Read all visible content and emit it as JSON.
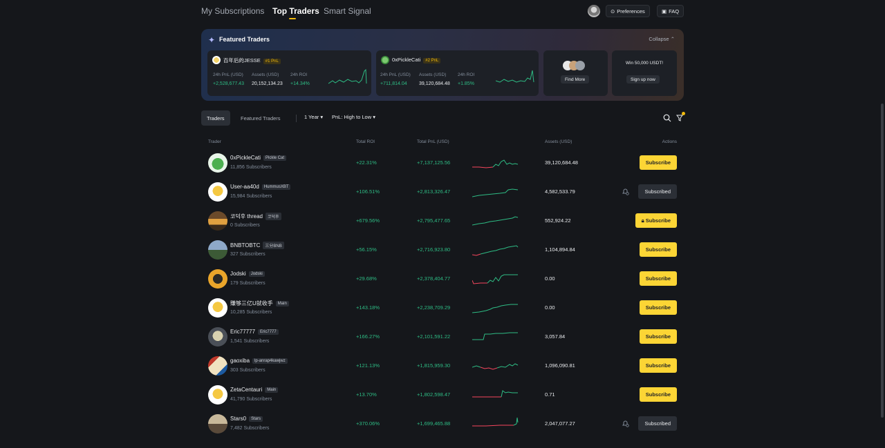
{
  "nav": {
    "tabs": [
      "My Subscriptions",
      "Top Traders",
      "Smart Signal"
    ],
    "preferences_label": "Preferences",
    "faq_label": "FAQ"
  },
  "featured": {
    "title": "Featured Traders",
    "collapse_label": "Collapse",
    "cards": [
      {
        "name": "百年后的JESSE",
        "rank": "#1 PnL",
        "pnl_label": "24h PnL (USD)",
        "pnl": "+2,528,677.43",
        "assets_label": "Assets (USD)",
        "assets": "20,152,134.23",
        "roi_label": "24h ROI",
        "roi": "+14.34%"
      },
      {
        "name": "0xPickleCati",
        "rank": "#2 PnL",
        "pnl_label": "24h PnL (USD)",
        "pnl": "+711,814.04",
        "assets_label": "Assets (USD)",
        "assets": "39,120,684.48",
        "roi_label": "24h ROI",
        "roi": "+1.85%"
      }
    ],
    "find_more_label": "Find More",
    "promo_text": "Win 50,000 USDT!",
    "signup_label": "Sign up now"
  },
  "filters": {
    "tabs": [
      "Traders",
      "Featured Traders"
    ],
    "period": "1 Year",
    "sort": "PnL: High to Low"
  },
  "table": {
    "headers": {
      "trader": "Trader",
      "roi": "Total ROI",
      "pnl": "Total PnL (USD)",
      "assets": "Assets (USD)",
      "actions": "Actions"
    },
    "rows": [
      {
        "name": "0xPickleCati",
        "tag": "Pickle Cat",
        "subs": "11,856 Subscribers",
        "roi": "+22.31%",
        "pnl": "+7,137,125.56",
        "assets": "39,120,684.48",
        "action": "Subscribe"
      },
      {
        "name": "User-aa40d",
        "tag": "HummusXBT",
        "subs": "15,984 Subscribers",
        "roi": "+106.51%",
        "pnl": "+2,813,326.47",
        "assets": "4,582,533.79",
        "action": "Subscribed"
      },
      {
        "name": "코덕후 thread",
        "tag": "코덕후",
        "subs": "0 Subscribers",
        "roi": "+679.56%",
        "pnl": "+2,795,477.65",
        "assets": "552,924.22",
        "action": "Subscribe"
      },
      {
        "name": "BNBTOBTC",
        "tag": "三分BNB",
        "subs": "327 Subscribers",
        "roi": "+56.15%",
        "pnl": "+2,716,923.80",
        "assets": "1,104,894.84",
        "action": "Subscribe"
      },
      {
        "name": "Jodski",
        "tag": "Jodski",
        "subs": "179 Subscribers",
        "roi": "+29.68%",
        "pnl": "+2,378,404.77",
        "assets": "0.00",
        "action": "Subscribe"
      },
      {
        "name": "賺够三亿U就收手",
        "tag": "Main",
        "subs": "10,285 Subscribers",
        "roi": "+143.18%",
        "pnl": "+2,238,709.29",
        "assets": "0.00",
        "action": "Subscribe"
      },
      {
        "name": "Eric77777",
        "tag": "Eric7777",
        "subs": "1,541 Subscribers",
        "roi": "+166.27%",
        "pnl": "+2,101,591.22",
        "assets": "3,057.84",
        "action": "Subscribe"
      },
      {
        "name": "gaoxiba",
        "tag": "lp-anrap4kawjwz",
        "subs": "303 Subscribers",
        "roi": "+121.13%",
        "pnl": "+1,815,959.30",
        "assets": "1,096,090.81",
        "action": "Subscribe"
      },
      {
        "name": "ZetaCentauri",
        "tag": "Main",
        "subs": "41,790 Subscribers",
        "roi": "+13.70%",
        "pnl": "+1,802,598.47",
        "assets": "0.71",
        "action": "Subscribe"
      },
      {
        "name": "Stars0",
        "tag": "Stars",
        "subs": "7,482 Subscribers",
        "roi": "+370.06%",
        "pnl": "+1,699,465.88",
        "assets": "2,047,077.27",
        "action": "Subscribed"
      }
    ]
  },
  "colors": {
    "accent": "#fcd535",
    "positive": "#2ebd85",
    "negative": "#f6465d"
  }
}
